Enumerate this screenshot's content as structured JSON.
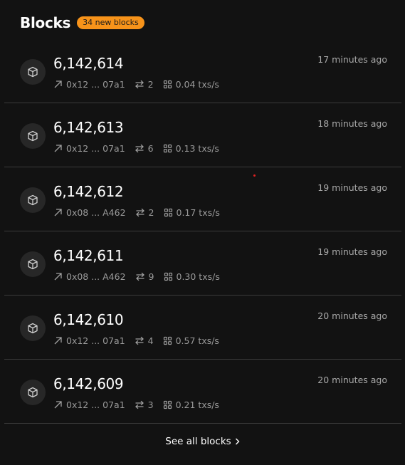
{
  "header": {
    "title": "Blocks",
    "badge": "34 new blocks"
  },
  "colors": {
    "background": "#121212",
    "badge": "#f7931a",
    "divider": "#3a3a3a"
  },
  "blocks": [
    {
      "height": "6,142,614",
      "miner": "0x12 ... 07a1",
      "tx_count": "2",
      "rate": "0.04 txs/s",
      "age": "17 minutes ago"
    },
    {
      "height": "6,142,613",
      "miner": "0x12 ... 07a1",
      "tx_count": "6",
      "rate": "0.13 txs/s",
      "age": "18 minutes ago"
    },
    {
      "height": "6,142,612",
      "miner": "0x08 ... A462",
      "tx_count": "2",
      "rate": "0.17 txs/s",
      "age": "19 minutes ago"
    },
    {
      "height": "6,142,611",
      "miner": "0x08 ... A462",
      "tx_count": "9",
      "rate": "0.30 txs/s",
      "age": "19 minutes ago"
    },
    {
      "height": "6,142,610",
      "miner": "0x12 ... 07a1",
      "tx_count": "4",
      "rate": "0.57 txs/s",
      "age": "20 minutes ago"
    },
    {
      "height": "6,142,609",
      "miner": "0x12 ... 07a1",
      "tx_count": "3",
      "rate": "0.21 txs/s",
      "age": "20 minutes ago"
    }
  ],
  "icons": {
    "block": "cube-icon",
    "miner": "arrow-up-right-icon",
    "transactions": "swap-arrows-icon",
    "rate": "grid-icon",
    "see_all": "chevron-right-icon"
  },
  "footer": {
    "see_all_label": "See all blocks"
  }
}
